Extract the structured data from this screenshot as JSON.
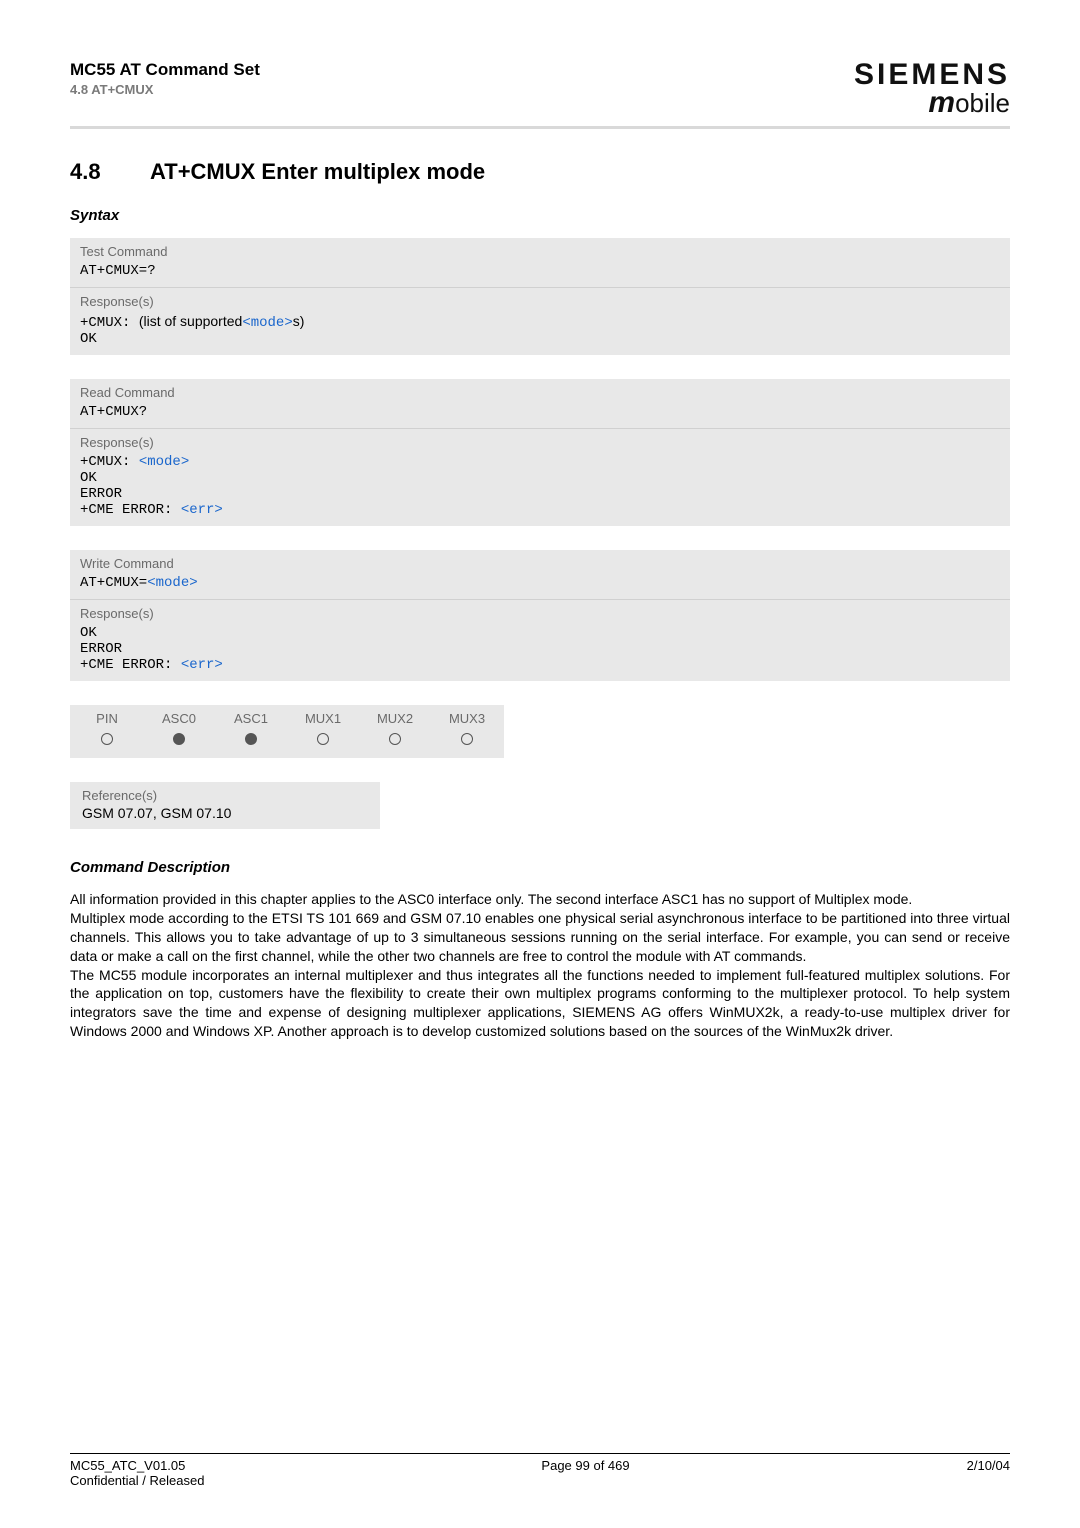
{
  "header": {
    "title": "MC55 AT Command Set",
    "subsection": "4.8 AT+CMUX",
    "brand_main": "SIEMENS",
    "brand_sub_m": "m",
    "brand_sub_rest": "obile"
  },
  "section": {
    "number": "4.8",
    "title": "AT+CMUX   Enter multiplex mode"
  },
  "syntax_label": "Syntax",
  "blocks": {
    "test": {
      "label": "Test Command",
      "cmd": "AT+CMUX=?",
      "resp_label": "Response(s)",
      "resp_prefix": "+CMUX: ",
      "resp_text_before": "(list of supported",
      "resp_param": "<mode>",
      "resp_text_after": "s)",
      "resp_ok": "OK"
    },
    "read": {
      "label": "Read Command",
      "cmd": "AT+CMUX?",
      "resp_label": "Response(s)",
      "resp_line1_prefix": "+CMUX: ",
      "resp_line1_param": "<mode>",
      "resp_ok": "OK",
      "resp_error": "ERROR",
      "resp_cme_prefix": "+CME ERROR: ",
      "resp_cme_param": "<err>"
    },
    "write": {
      "label": "Write Command",
      "cmd_prefix": "AT+CMUX=",
      "cmd_param": "<mode>",
      "resp_label": "Response(s)",
      "resp_ok": "OK",
      "resp_error": "ERROR",
      "resp_cme_prefix": "+CME ERROR: ",
      "resp_cme_param": "<err>"
    }
  },
  "support": {
    "headers": [
      "PIN",
      "ASC0",
      "ASC1",
      "MUX1",
      "MUX2",
      "MUX3"
    ],
    "values": [
      false,
      true,
      true,
      false,
      false,
      false
    ]
  },
  "reference": {
    "label": "Reference(s)",
    "text": "GSM 07.07, GSM 07.10"
  },
  "description": {
    "heading": "Command Description",
    "body": "All information provided in this chapter applies to the ASC0 interface only. The second interface ASC1 has no support of Multiplex mode.\nMultiplex mode according to the ETSI TS 101 669 and GSM 07.10 enables one physical serial asynchronous interface to be partitioned into three virtual channels. This allows you to take advantage of up to 3 simultaneous sessions running on the serial interface. For example, you can send or receive data or make a call on the first channel, while the other two channels are free to control the module with AT commands.\nThe MC55 module incorporates an internal multiplexer and thus integrates all the functions needed to implement full-featured multiplex solutions. For the application on top, customers have the flexibility to create their own multiplex programs conforming to the multiplexer protocol. To help system integrators save the time and expense of designing multiplexer applications, SIEMENS AG offers WinMUX2k, a ready-to-use multiplex driver for Windows 2000 and Windows XP. Another approach is to develop customized solutions based on the sources of the WinMux2k driver."
  },
  "footer": {
    "left_line1": "MC55_ATC_V01.05",
    "left_line2": "Confidential / Released",
    "center": "Page 99 of 469",
    "right": "2/10/04"
  }
}
